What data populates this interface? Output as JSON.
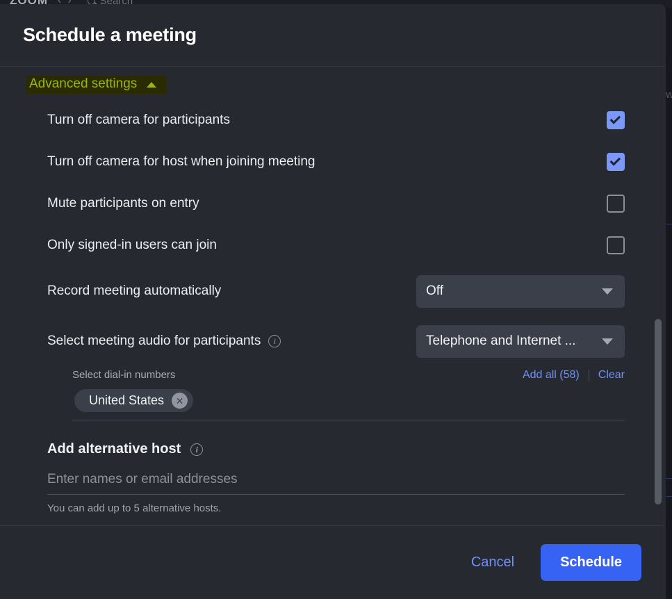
{
  "backdrop": {
    "logo": "ZOOM",
    "nav_back_icon": "chevron-left-icon",
    "nav_forward_icon": "chevron-right-icon",
    "search_icon": "search-icon",
    "search_placeholder": "Search",
    "right_fragment": "w"
  },
  "modal": {
    "title": "Schedule a meeting",
    "advanced_settings": {
      "label": "Advanced settings",
      "caret_icon": "caret-up-icon",
      "expanded": true,
      "highlight_bg": "#2b2b00",
      "highlight_fg": "#9ab610"
    },
    "settings": [
      {
        "label": "Turn off camera for participants",
        "control": "checkbox",
        "checked": true
      },
      {
        "label": "Turn off camera for host when joining meeting",
        "control": "checkbox",
        "checked": true
      },
      {
        "label": "Mute participants on entry",
        "control": "checkbox",
        "checked": false
      },
      {
        "label": "Only signed-in users can join",
        "control": "checkbox",
        "checked": false
      }
    ],
    "record_meeting": {
      "label": "Record meeting automatically",
      "value": "Off",
      "caret_icon": "caret-down-icon"
    },
    "meeting_audio": {
      "label": "Select meeting audio for participants",
      "info_icon": "info-icon",
      "value": "Telephone and Internet ...",
      "caret_icon": "caret-down-icon"
    },
    "dialin": {
      "label": "Select dial-in numbers",
      "add_all_label": "Add all (58)",
      "clear_label": "Clear",
      "chips": [
        {
          "label": "United States",
          "remove_icon": "close-circle-icon"
        }
      ]
    },
    "alternative_host": {
      "title": "Add alternative host",
      "info_icon": "info-icon",
      "placeholder": "Enter names or email addresses",
      "value": "",
      "help": "You can add up to 5 alternative hosts."
    },
    "footer": {
      "cancel_label": "Cancel",
      "schedule_label": "Schedule",
      "accent_color": "#3763f4",
      "link_color": "#6f91fa"
    },
    "scrollbar": {
      "orientation": "vertical",
      "thumb_color": "#575b64"
    }
  }
}
